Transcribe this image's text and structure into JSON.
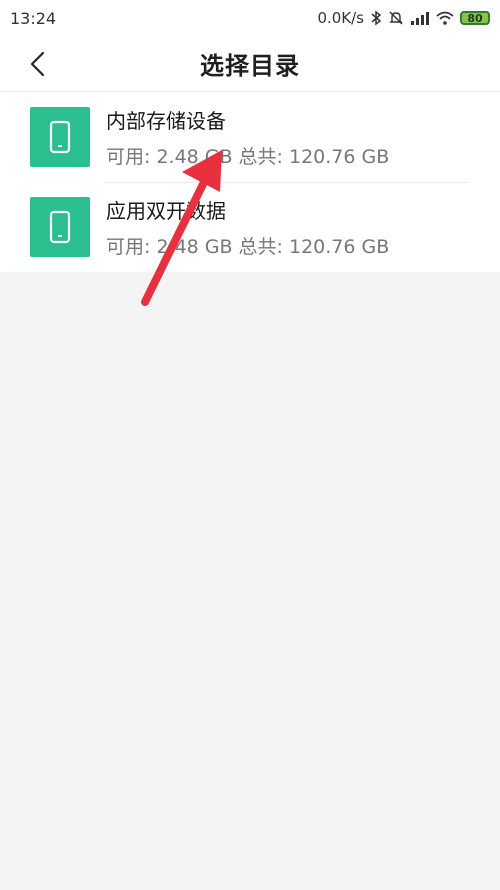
{
  "status_bar": {
    "time": "13:24",
    "network_speed": "0.0K/s",
    "battery_level": "80",
    "icons": [
      "bluetooth-icon",
      "mute-icon",
      "signal-icon",
      "wifi-icon",
      "battery-icon"
    ]
  },
  "header": {
    "back_icon": "chevron-left-icon",
    "title": "选择目录"
  },
  "items": [
    {
      "icon": "phone-storage-icon",
      "title": "内部存储设备",
      "available": "可用: 2.48 GB",
      "total": "总共: 120.76 GB"
    },
    {
      "icon": "phone-storage-icon",
      "title": "应用双开数据",
      "available": "可用: 2.48 GB",
      "total": "总共: 120.76 GB"
    }
  ],
  "colors": {
    "icon_bg": "#2bbf8f",
    "annotation_arrow": "#e8313f",
    "background": "#f4f4f4"
  }
}
